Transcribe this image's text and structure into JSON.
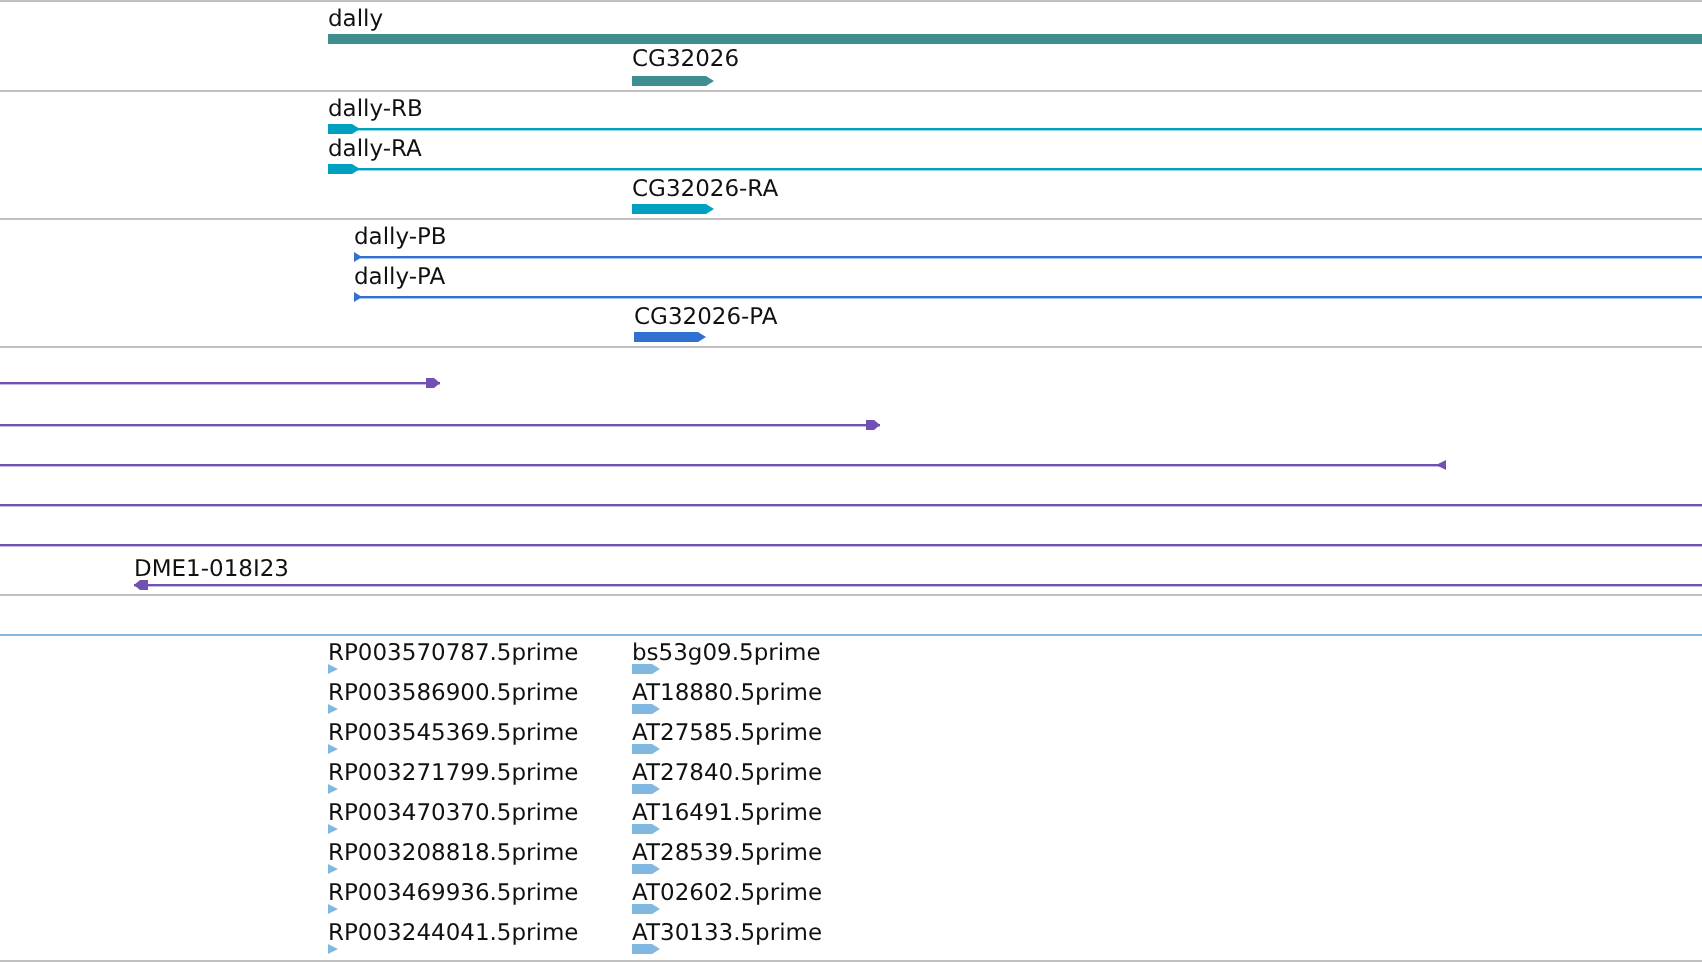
{
  "tracks": [
    {
      "kind": "gene",
      "features": [
        {
          "label": "dally"
        },
        {
          "label": "CG32026",
          "arrow": true,
          "reverse": false
        }
      ]
    },
    {
      "kind": "transcript",
      "features": [
        {
          "label": "dally-RB",
          "arrow": true,
          "reverse": false
        },
        {
          "label": "dally-RA",
          "arrow": true,
          "reverse": false
        },
        {
          "label": "CG32026-RA",
          "arrow": true,
          "reverse": false
        }
      ]
    },
    {
      "kind": "protein",
      "features": [
        {
          "label": "dally-PB",
          "arrow": true,
          "reverse": false
        },
        {
          "label": "dally-PA",
          "arrow": true,
          "reverse": false
        },
        {
          "label": "CG32026-PA",
          "arrow": true,
          "reverse": false
        }
      ]
    },
    {
      "kind": "match",
      "features": [
        {
          "arrow": true,
          "reverse": false
        },
        {
          "arrow": true,
          "reverse": false
        },
        {
          "arrow": true,
          "reverse": true
        },
        {
          "arrow": false
        },
        {
          "arrow": false
        },
        {
          "label": "DME1-018I23",
          "arrow": true,
          "reverse": true
        }
      ]
    },
    {
      "kind": "empty"
    },
    {
      "kind": "prime",
      "features": [
        {
          "label": "RP003570787.5prime",
          "arrow": true,
          "reverse": false
        },
        {
          "label": "bs53g09.5prime",
          "arrow": true,
          "reverse": false
        },
        {
          "label": "RP003586900.5prime",
          "arrow": true,
          "reverse": false
        },
        {
          "label": "AT18880.5prime",
          "arrow": true,
          "reverse": false
        },
        {
          "label": "RP003545369.5prime",
          "arrow": true,
          "reverse": false
        },
        {
          "label": "AT27585.5prime",
          "arrow": true,
          "reverse": false
        },
        {
          "label": "RP003271799.5prime",
          "arrow": true,
          "reverse": false
        },
        {
          "label": "AT27840.5prime",
          "arrow": true,
          "reverse": false
        },
        {
          "label": "RP003470370.5prime",
          "arrow": true,
          "reverse": false
        },
        {
          "label": "AT16491.5prime",
          "arrow": true,
          "reverse": false
        },
        {
          "label": "RP003208818.5prime",
          "arrow": true,
          "reverse": false
        },
        {
          "label": "AT28539.5prime",
          "arrow": true,
          "reverse": false
        },
        {
          "label": "RP003469936.5prime",
          "arrow": true,
          "reverse": false
        },
        {
          "label": "AT02602.5prime",
          "arrow": true,
          "reverse": false
        },
        {
          "label": "RP003244041.5prime",
          "arrow": true,
          "reverse": false
        },
        {
          "label": "AT30133.5prime",
          "arrow": true,
          "reverse": false
        }
      ]
    }
  ]
}
